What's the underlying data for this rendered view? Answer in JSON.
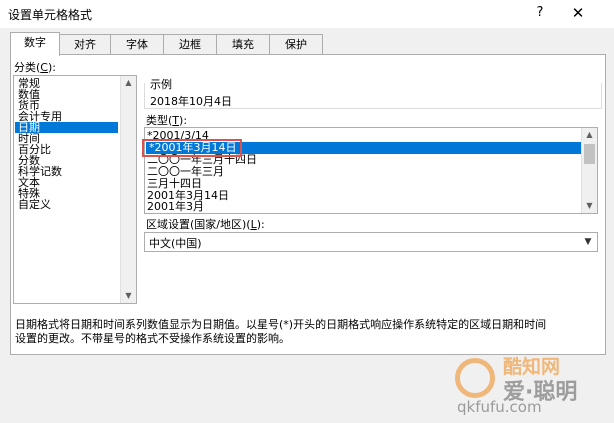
{
  "window": {
    "title": "设置单元格格式",
    "help": "?",
    "close": "✕"
  },
  "tabs": [
    {
      "label": "数字",
      "active": true
    },
    {
      "label": "对齐",
      "active": false
    },
    {
      "label": "字体",
      "active": false
    },
    {
      "label": "边框",
      "active": false
    },
    {
      "label": "填充",
      "active": false
    },
    {
      "label": "保护",
      "active": false
    }
  ],
  "category": {
    "label_pre": "分类(",
    "label_key": "C",
    "label_post": "):",
    "items": [
      "常规",
      "数值",
      "货币",
      "会计专用",
      "日期",
      "时间",
      "百分比",
      "分数",
      "科学记数",
      "文本",
      "特殊",
      "自定义"
    ],
    "selected": "日期"
  },
  "sample": {
    "label": "示例",
    "value": "2018年10月4日"
  },
  "type": {
    "label_pre": "类型(",
    "label_key": "T",
    "label_post": "):",
    "items": [
      "*2001/3/14",
      "*2001年3月14日",
      "二〇〇一年三月十四日",
      "二〇〇一年三月",
      "三月十四日",
      "2001年3月14日",
      "2001年3月"
    ],
    "selected": "*2001年3月14日"
  },
  "locale": {
    "label_pre": "区域设置(国家/地区)(",
    "label_key": "L",
    "label_post": "):",
    "value": "中文(中国)"
  },
  "description": {
    "line1": "日期格式将日期和时间系列数值显示为日期值。以星号(*)开头的日期格式响应操作系统特定的区域日期和时间",
    "line2": "设置的更改。不带星号的格式不受操作系统设置的影响。"
  },
  "watermark": {
    "brand": "酷知网",
    "text": "爱·聪明",
    "url": "qkfufu.com"
  },
  "icons": {
    "scroll_up": "scroll-up-icon",
    "scroll_down": "scroll-down-icon",
    "dropdown": "chevron-down-icon"
  },
  "colors": {
    "selection": "#0078d7",
    "highlight_border": "#d9534f",
    "watermark_orange": "#f08a1b"
  }
}
